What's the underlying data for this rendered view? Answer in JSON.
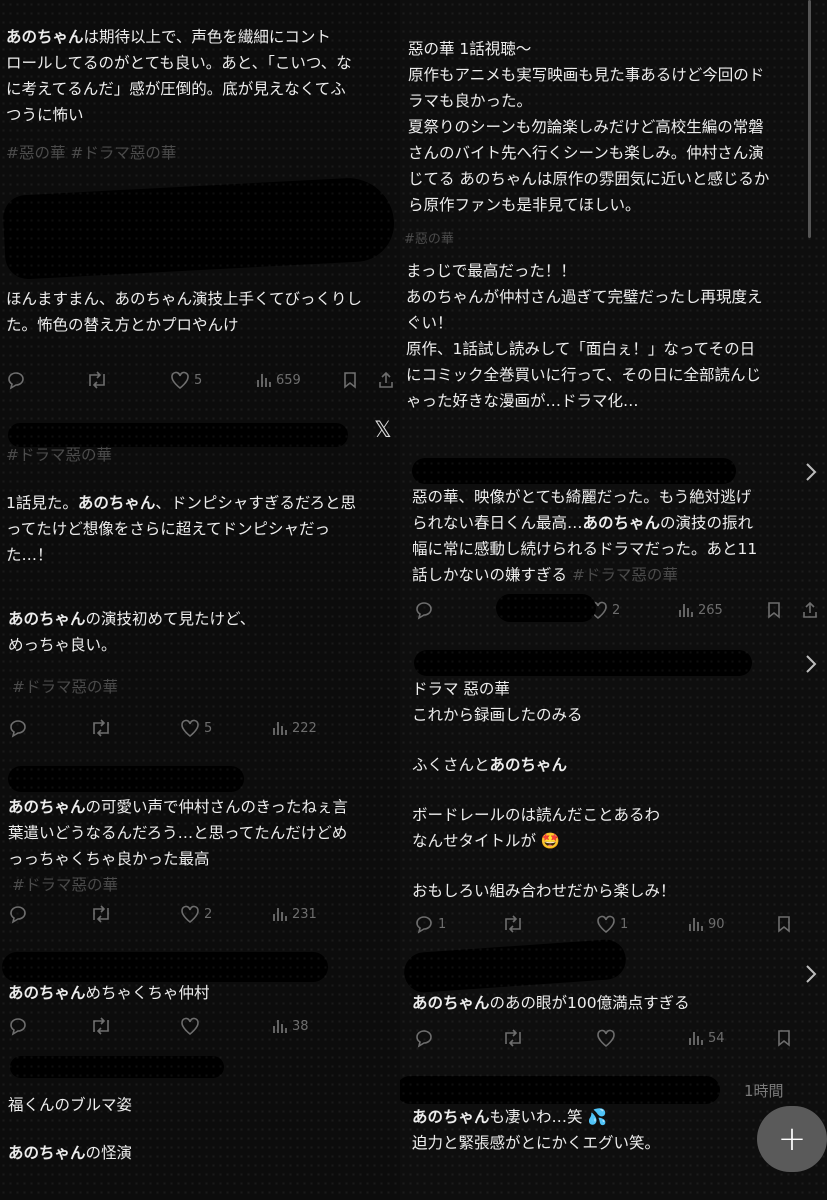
{
  "left": {
    "post1": {
      "lines": [
        "ロールしてるのがとても良い。あと、「こいつ、な",
        "に考えてるんだ」感が圧倒的。底が見えなくてふ",
        "つうに怖い"
      ],
      "first_bold": "あのちゃん",
      "first_rest": "は期待以上で、声色を繊細にコント",
      "tags": "#惡の華 #ドラマ惡の華"
    },
    "post2": {
      "text": "ほんますまん、あのちゃん演技上手くてびっくりし\nた。怖色の替え方とかプロやんけ",
      "likes": "5",
      "views": "659"
    },
    "x_logo": "𝕏",
    "post3": {
      "tag_top": "#ドラマ惡の華",
      "line1_pre": "1話見た。",
      "line1_bold": "あのちゃん",
      "line1_post": "、ドンピシャすぎるだろと思",
      "rest": "ってたけど想像をさらに超えてドンピシャだっ\nた…！"
    },
    "post4": {
      "bold": "あのちゃん",
      "rest": "の演技初めて見たけど、\nめっちゃ良い。",
      "tag": "#ドラマ惡の華",
      "likes": "5",
      "views": "222"
    },
    "post5": {
      "bold": "あのちゃん",
      "rest": "の可愛い声で仲村さんのきったねぇ言\n葉遣いどうなるんだろう…と思ってたんだけどめ\nっっちゃくちゃ良かった最高",
      "tag": "#ドラマ惡の華",
      "likes": "2",
      "views": "231"
    },
    "post6": {
      "bold": "あのちゃん",
      "rest": "めちゃくちゃ仲村",
      "views": "38"
    },
    "post7": {
      "line1": "福くんのブルマ姿",
      "bold": "あのちゃん",
      "rest": "の怪演"
    }
  },
  "right": {
    "post1": {
      "text": "惡の華 1話視聴〜\n原作もアニメも実写映画も見た事あるけど今回のド\nラマも良かった。\n夏祭りのシーンも勿論楽しみだけど高校生編の常磐\nさんのバイト先へ行くシーンも楽しみ。仲村さん演\nじてる あのちゃんは原作の雰囲気に近いと感じるか\nら原作ファンも是非見てほしい。",
      "tag": "#惡の華"
    },
    "post2": {
      "text": "まっじで最高だった！！\nあのちゃんが仲村さん過ぎて完璧だったし再現度え\nぐい！\n原作、1話試し読みして「面白ぇ！」なってその日\nにコミック全巻買いに行って、その日に全部読んじ\nゃった好きな漫画が…ドラマ化…"
    },
    "post3": {
      "line1": "惡の華、映像がとても綺麗だった。もう絶対逃げ",
      "line2_pre": "られない春日くん最高…",
      "line2_bold": "あのちゃん",
      "line2_post": "の演技の振れ",
      "line3": "幅に常に感動し続けられるドラマだった。あと11",
      "line4": "話しかないの嫌すぎる ",
      "line4_tag": "#ドラマ惡の華",
      "likes": "2",
      "views": "265"
    },
    "post4": {
      "text1": "ドラマ 惡の華\nこれから録画したのみる",
      "pre": "ふくさんと",
      "bold": "あのちゃん",
      "text2": "ボードレールのは読んだことあるわ\nなんせタイトルが 🤩",
      "text3": "おもしろい組み合わせだから楽しみ！",
      "replies": "1",
      "likes": "1",
      "views": "90"
    },
    "post5": {
      "bold": "あのちゃん",
      "rest": "のあの眼が100億満点すぎる",
      "views": "54"
    },
    "post6": {
      "time": "1時間",
      "bold": "あのちゃん",
      "rest": "も凄いわ…笑 💦",
      "line2": "迫力と緊張感がとにかくエグい笑。"
    }
  },
  "fab_label": "+"
}
